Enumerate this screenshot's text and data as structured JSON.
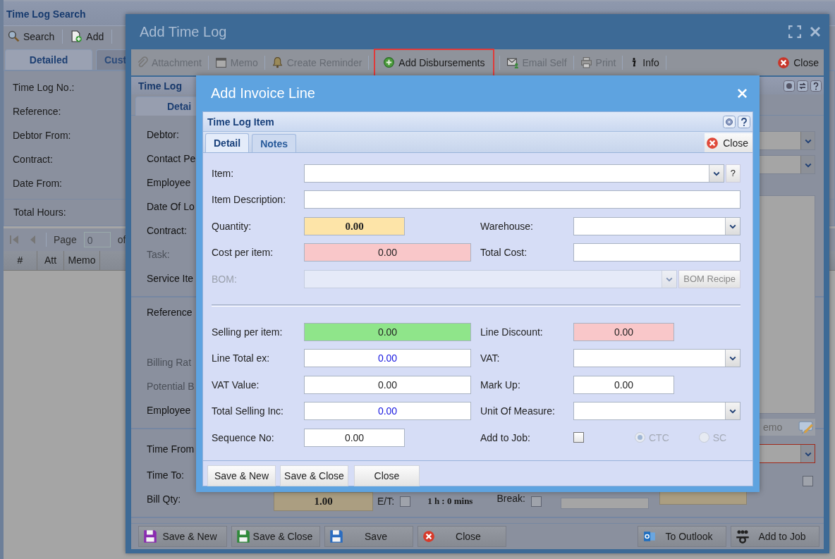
{
  "search_panel": {
    "title": "Time Log Search",
    "toolbar": [
      {
        "label": "Search"
      },
      {
        "label": "Add"
      }
    ],
    "tabs": [
      {
        "label": "Detailed",
        "selected": true
      },
      {
        "label": "Cust",
        "selected": false
      }
    ],
    "fields": [
      "Time Log No.:",
      "Reference:",
      "Debtor From:",
      "Contract:",
      "Date From:"
    ],
    "total_label": "Total Hours:",
    "pager": {
      "label": "Page",
      "value": "0",
      "of": "of"
    },
    "columns": [
      "#",
      "Att",
      "Memo"
    ]
  },
  "time_log": {
    "title": "Add Time Log",
    "toolbar": [
      {
        "label": "Attachment",
        "disabled": true,
        "highlighted": false
      },
      {
        "label": "Memo",
        "disabled": true,
        "highlighted": false
      },
      {
        "label": "Create Reminder",
        "disabled": true,
        "highlighted": false
      },
      {
        "label": "Add Disbursements",
        "disabled": false,
        "highlighted": true
      },
      {
        "label": "Email Self",
        "disabled": true,
        "highlighted": false
      },
      {
        "label": "Print",
        "disabled": true,
        "highlighted": false
      },
      {
        "label": "Info",
        "disabled": false,
        "highlighted": false
      }
    ],
    "close": "Close",
    "panel_title": "Time Log",
    "tabs": [
      {
        "label": "Detai",
        "selected": true
      }
    ],
    "sections": [
      [
        {
          "label": "Debtor:",
          "disabled": false,
          "kind": "line"
        },
        {
          "label": "Contact Pe",
          "disabled": false,
          "kind": "line"
        },
        {
          "label": "Employee",
          "disabled": false,
          "kind": "line"
        },
        {
          "label": "Date Of Lo",
          "disabled": false,
          "kind": "line"
        },
        {
          "label": "Contract:",
          "disabled": false,
          "kind": "line"
        },
        {
          "label": "Task:",
          "disabled": true,
          "kind": "line"
        },
        {
          "label": "Service Ite",
          "disabled": false,
          "kind": "line"
        }
      ],
      [
        {
          "label": "Reference",
          "disabled": false,
          "kind": "tall"
        },
        {
          "label": "Billing Rat",
          "disabled": true,
          "kind": "line"
        },
        {
          "label": "Potential B",
          "disabled": true,
          "kind": "line"
        },
        {
          "label": "Employee",
          "disabled": false,
          "kind": "line"
        }
      ],
      [
        {
          "label": "Time From",
          "disabled": false,
          "kind": "wide"
        },
        {
          "label": "Time To:",
          "disabled": false,
          "kind": "line"
        },
        {
          "label": "Bill Qty:",
          "disabled": false,
          "kind": "line"
        }
      ]
    ],
    "memo_label": "emo",
    "time_to_checked": false,
    "bill_qty": "1.00",
    "et_label": "E/T:",
    "et_checked": false,
    "duration": "1 h : 0 mins",
    "break_label": "Break:",
    "break_checked": false,
    "buttons": [
      "Save & New",
      "Save & Close",
      "Save",
      "Close",
      "To Outlook",
      "Add to Job"
    ]
  },
  "invoice_line": {
    "title": "Add Invoice Line",
    "panel_title": "Time Log Item",
    "tabs": [
      {
        "label": "Detail",
        "selected": true
      },
      {
        "label": "Notes",
        "selected": false
      }
    ],
    "close": "Close",
    "rows": [
      {
        "kind": "fields",
        "fields": [
          {
            "label": "Item:",
            "kind": "combo",
            "button": "?",
            "disabled": false
          }
        ]
      },
      {
        "kind": "fields",
        "fields": [
          {
            "label": "Item Description:",
            "kind": "long_text"
          }
        ]
      },
      {
        "kind": "fields",
        "fields": [
          {
            "label": "Quantity:",
            "kind": "short_text",
            "value": "0.00",
            "color": "#fde4a8",
            "bold": true
          },
          {
            "label": "Warehouse:",
            "kind": "dropdown",
            "disabled": false
          }
        ]
      },
      {
        "kind": "fields",
        "fields": [
          {
            "label": "Cost per item:",
            "kind": "text",
            "value": "0.00",
            "color": "#f9c7c9"
          },
          {
            "label": "Total Cost:",
            "kind": "text"
          }
        ]
      },
      {
        "kind": "fields",
        "fields": [
          {
            "label": "BOM:",
            "kind": "combo",
            "disabled": true,
            "button": "BOM Recipe"
          }
        ]
      },
      {
        "kind": "separator"
      },
      {
        "kind": "fields",
        "fields": [
          {
            "label": "Selling per item:",
            "kind": "text",
            "value": "0.00",
            "color": "#8fe58a"
          },
          {
            "label": "Line Discount:",
            "kind": "short_text",
            "value": "0.00",
            "color": "#f9c7c9"
          }
        ]
      },
      {
        "kind": "fields",
        "fields": [
          {
            "label": "Line Total ex:",
            "kind": "text",
            "value": "0.00",
            "calculated": true
          },
          {
            "label": "VAT:",
            "kind": "dropdown",
            "disabled": false
          }
        ]
      },
      {
        "kind": "fields",
        "fields": [
          {
            "label": "VAT Value:",
            "kind": "text",
            "value": "0.00"
          },
          {
            "label": "Mark Up:",
            "kind": "short_text",
            "value": "0.00"
          }
        ]
      },
      {
        "kind": "fields",
        "fields": [
          {
            "label": "Total Selling Inc:",
            "kind": "text",
            "value": "0.00",
            "calculated": true
          },
          {
            "label": "Unit Of Measure:",
            "kind": "dropdown",
            "disabled": false
          }
        ]
      },
      {
        "kind": "fields",
        "fields": [
          {
            "label": "Sequence No:",
            "kind": "short_text",
            "value": "0.00"
          },
          {
            "label": "Add to Job:",
            "kind": "checkbox",
            "checked": false,
            "options": [
              {
                "label": "CTC",
                "selected": true,
                "disabled": true
              },
              {
                "label": "SC",
                "selected": false,
                "disabled": true
              }
            ]
          }
        ]
      }
    ],
    "buttons": [
      "Save & New",
      "Save & Close",
      "Close"
    ]
  }
}
